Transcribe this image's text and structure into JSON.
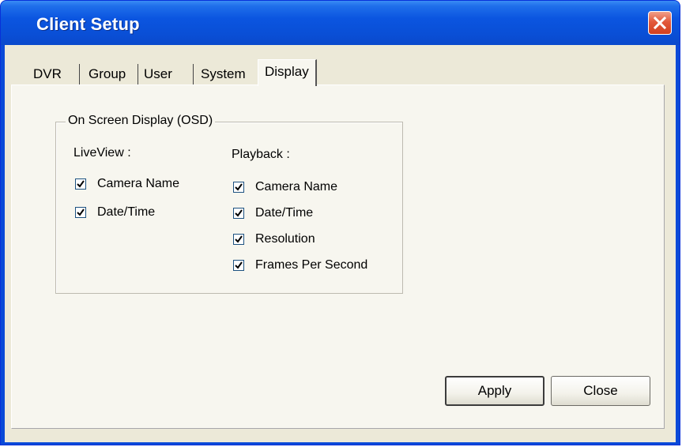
{
  "window": {
    "title": "Client Setup"
  },
  "tabs": [
    {
      "label": "DVR"
    },
    {
      "label": "Group"
    },
    {
      "label": "User"
    },
    {
      "label": "System"
    },
    {
      "label": "Display"
    }
  ],
  "active_tab": "Display",
  "osd": {
    "title": "On Screen Display (OSD)",
    "liveview": {
      "label": "LiveView :",
      "options": [
        {
          "label": "Camera Name",
          "checked": true
        },
        {
          "label": "Date/Time",
          "checked": true
        }
      ]
    },
    "playback": {
      "label": "Playback :",
      "options": [
        {
          "label": "Camera Name",
          "checked": true
        },
        {
          "label": "Date/Time",
          "checked": true
        },
        {
          "label": "Resolution",
          "checked": true
        },
        {
          "label": "Frames Per Second",
          "checked": true
        }
      ]
    }
  },
  "buttons": {
    "apply": "Apply",
    "close": "Close"
  },
  "icons": {
    "close": "close-icon",
    "check": "checkmark-icon"
  },
  "colors": {
    "titlebar": "#0a4fd6",
    "close_button": "#d2401f",
    "dialog_bg": "#ece9d8"
  }
}
